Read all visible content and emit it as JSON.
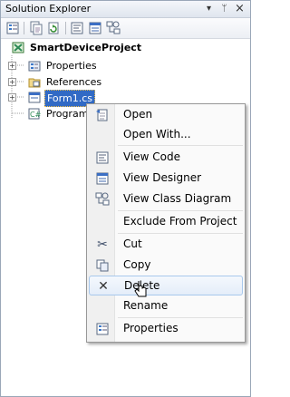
{
  "panel": {
    "title": "Solution Explorer",
    "pin_glyph": "ᛘ",
    "float_glyph": "▾",
    "close_glyph": "×"
  },
  "toolbar": {
    "icons": [
      "properties-icon",
      "show-all-files-icon",
      "refresh-icon",
      "view-code-icon",
      "view-designer-icon",
      "view-class-diagram-icon"
    ]
  },
  "tree": {
    "project": "SmartDeviceProject",
    "items": [
      {
        "label": "Properties",
        "icon": "properties-folder-icon"
      },
      {
        "label": "References",
        "icon": "references-folder-icon"
      },
      {
        "label": "Form1.cs",
        "icon": "form-file-icon"
      },
      {
        "label": "Program",
        "icon": "csharp-file-icon"
      }
    ],
    "expander_glyph": "+"
  },
  "context_menu": {
    "items": [
      {
        "label": "Open",
        "icon": "open-icon"
      },
      {
        "label": "Open With...",
        "icon": ""
      },
      {
        "label": "View Code",
        "icon": "view-code-icon"
      },
      {
        "label": "View Designer",
        "icon": "view-designer-icon"
      },
      {
        "label": "View Class Diagram",
        "icon": "view-class-diagram-icon"
      },
      {
        "label": "Exclude From Project",
        "icon": ""
      },
      {
        "label": "Cut",
        "icon": "cut-icon"
      },
      {
        "label": "Copy",
        "icon": "copy-icon"
      },
      {
        "label": "Delete",
        "icon": "delete-icon",
        "highlighted": true
      },
      {
        "label": "Rename",
        "icon": ""
      },
      {
        "label": "Properties",
        "icon": "properties-icon"
      }
    ],
    "delete_glyph": "✕",
    "cut_glyph": "✂"
  }
}
